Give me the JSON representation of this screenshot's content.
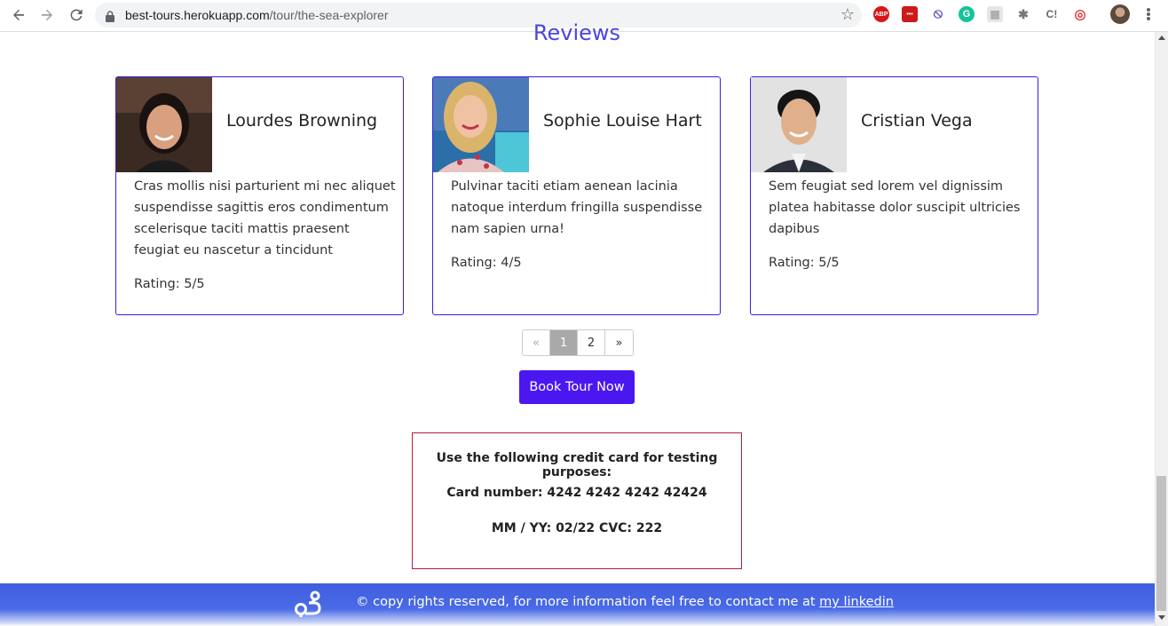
{
  "browser": {
    "url_host": "best-tours.herokuapp.com",
    "url_path": "/tour/the-sea-explorer",
    "extensions": [
      "ABP",
      "•••",
      "⦸",
      "G",
      "▦",
      "✱",
      "C!",
      "◎"
    ],
    "icons": {
      "back": "arrow-left-icon",
      "forward": "arrow-right-icon",
      "reload": "reload-icon",
      "lock": "lock-icon",
      "star": "star-icon",
      "menu": "kebab-menu-icon"
    }
  },
  "reviews": {
    "title": "Reviews",
    "items": [
      {
        "name": "Lourdes Browning",
        "text": "Cras mollis nisi parturient mi nec aliquet suspendisse sagittis eros condimentum scelerisque taciti mattis praesent feugiat eu nascetur a tincidunt",
        "rating": "Rating: 5/5"
      },
      {
        "name": "Sophie Louise Hart",
        "text": "Pulvinar taciti etiam aenean lacinia natoque interdum fringilla suspendisse nam sapien urna!",
        "rating": "Rating: 4/5"
      },
      {
        "name": "Cristian Vega",
        "text": "Sem feugiat sed lorem vel dignissim platea habitasse dolor suscipit ultricies dapibus",
        "rating": "Rating: 5/5"
      }
    ]
  },
  "pagination": {
    "prev": "«",
    "pages": [
      "1",
      "2"
    ],
    "next": "»",
    "current": "1"
  },
  "book_button": "Book Tour Now",
  "credit_card": {
    "line1": "Use the following credit card for testing purposes:",
    "line2": "Card number: 4242 4242 4242 42424",
    "line3": "MM / YY: 02/22 CVC: 222"
  },
  "footer": {
    "text": "© copy rights reserved, for more information feel free to contact me at",
    "link": "my linkedin"
  },
  "colors": {
    "accent": "#4b17f0",
    "card_border": "#3b1ee0",
    "cc_border": "#b71c3c",
    "footer": "#3f5fe0"
  }
}
